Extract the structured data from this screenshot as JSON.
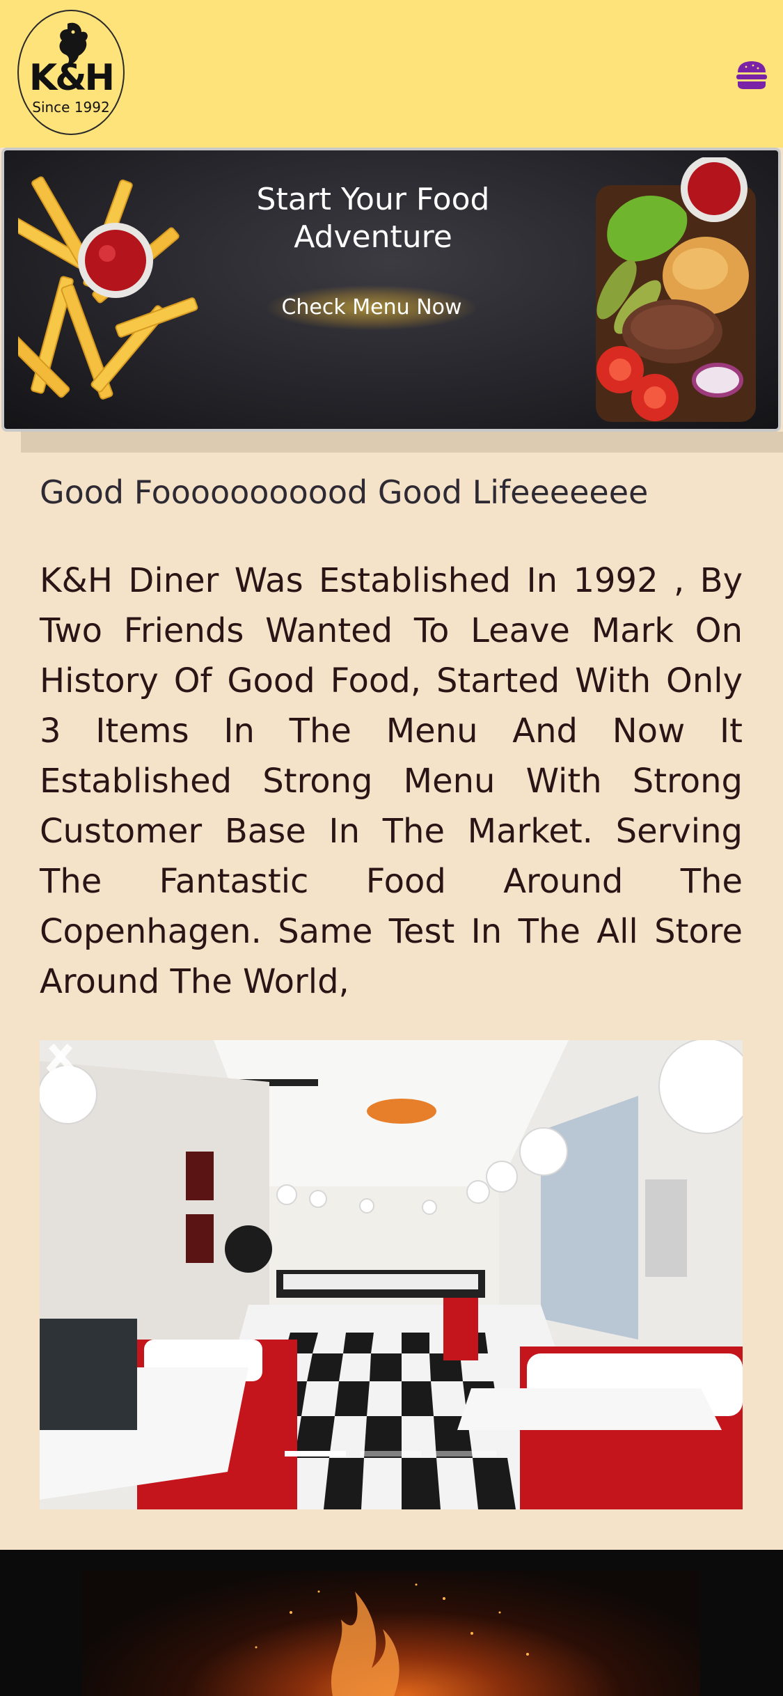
{
  "header": {
    "logo_text": "K&H",
    "logo_since": "Since 1992",
    "menu_icon": "hamburger-menu-icon"
  },
  "banner": {
    "title": "Start Your Food Adventure",
    "cta_label": "Check Menu Now"
  },
  "about": {
    "subtitle": "Good Fooooooooood Good Lifeeeeeee",
    "description": "K&H Diner Was Established In 1992 , By Two Friends Wanted To Leave Mark On History Of Good Food, Started With Only 3 Items In The Menu And Now It Established Strong Menu With Strong Customer Base In The Market. Serving The Fantastic Food Around The Copenhagen. Same Test In The All Store Around The World,"
  },
  "carousel": {
    "prev_icon": "chevron-left-icon",
    "next_icon": "chevron-right-icon",
    "slide_count": 3,
    "active_slide": 1
  },
  "colors": {
    "header_bg": "#fee27a",
    "page_bg": "#f4e3c8",
    "accent_purple": "#7a23a6",
    "dark_section": "#0b0b0b"
  }
}
